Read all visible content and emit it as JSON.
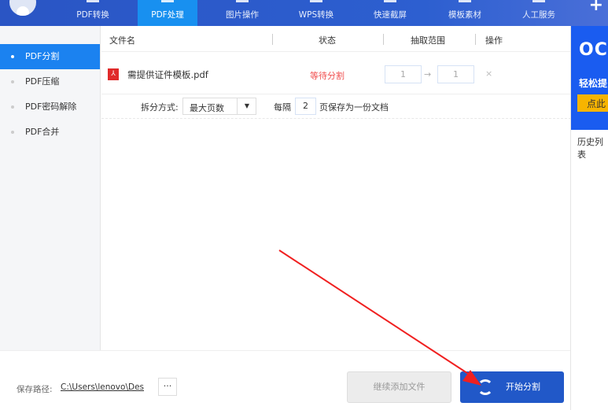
{
  "nav": {
    "tabs": [
      {
        "label": "PDF转换"
      },
      {
        "label": "PDF处理"
      },
      {
        "label": "图片操作"
      },
      {
        "label": "WPS转换"
      },
      {
        "label": "快速截屏"
      },
      {
        "label": "模板素材"
      },
      {
        "label": "人工服务"
      }
    ],
    "plus": "+"
  },
  "sidebar": {
    "items": [
      {
        "label": "PDF分割"
      },
      {
        "label": "PDF压缩"
      },
      {
        "label": "PDF密码解除"
      },
      {
        "label": "PDF合并"
      }
    ]
  },
  "table": {
    "headers": {
      "name": "文件名",
      "status": "状态",
      "range": "抽取范围",
      "ops": "操作"
    },
    "rows": [
      {
        "icon": "pdf-icon",
        "name": "需提供证件模板.pdf",
        "status": "等待分割",
        "from": "1",
        "to": "1",
        "arrow": "→",
        "delete": "×"
      }
    ]
  },
  "options": {
    "label": "拆分方式:",
    "mode": "最大页数",
    "every_label": "每隔",
    "every_value": "2",
    "suffix": "页保存为一份文档"
  },
  "ad": {
    "title": "OC",
    "line1": "轻松提",
    "button": "点此"
  },
  "history": "历史列表",
  "footer": {
    "path_label": "保存路径:",
    "path": "C:\\Users\\lenovo\\Des",
    "more": "···",
    "add_button": "继续添加文件",
    "start_button": "开始分割"
  },
  "colors": {
    "nav": "#2a55c4",
    "active": "#1890f0",
    "start": "#2158c8",
    "status": "#f05050"
  }
}
